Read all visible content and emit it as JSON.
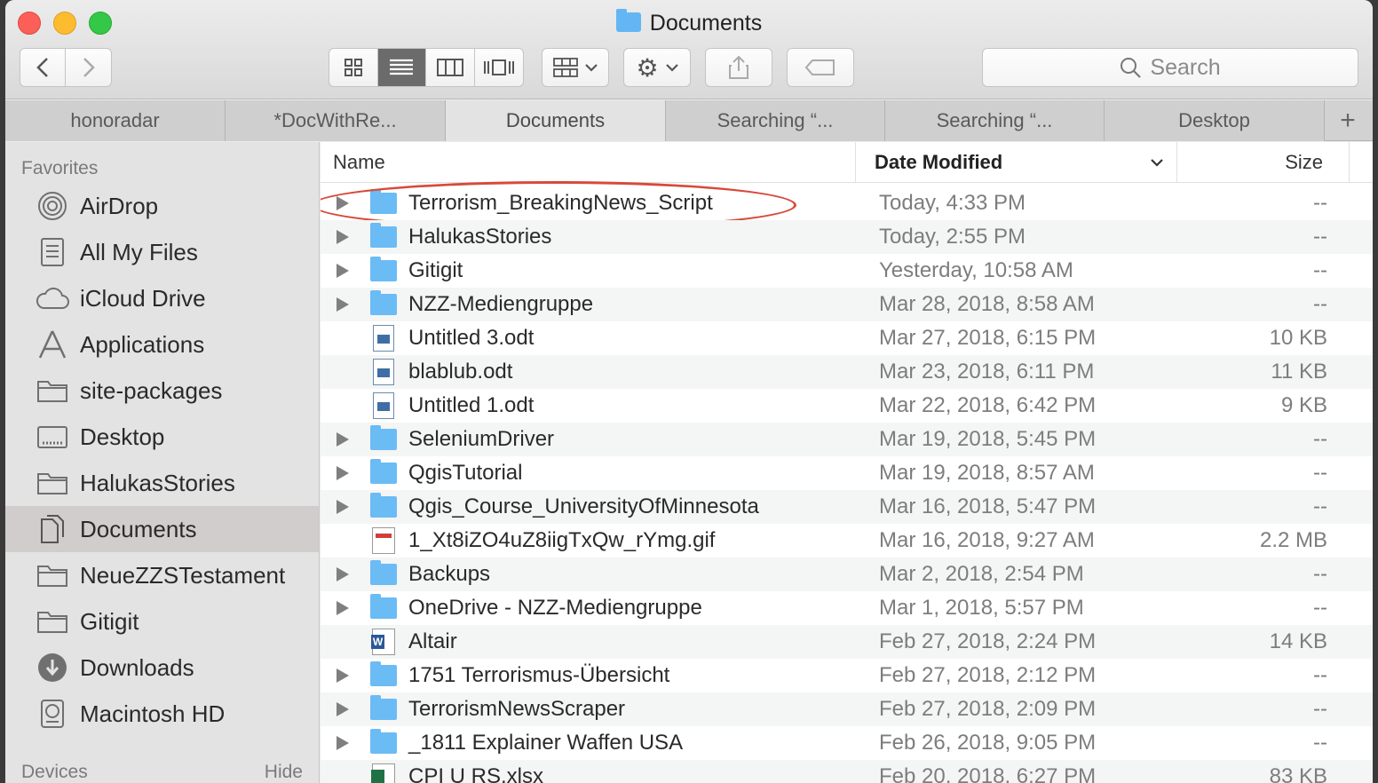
{
  "window": {
    "title": "Documents"
  },
  "toolbar": {
    "search_placeholder": "Search"
  },
  "tabs": [
    {
      "label": "honoradar"
    },
    {
      "label": "*DocWithRe..."
    },
    {
      "label": "Documents"
    },
    {
      "label": "Searching “..."
    },
    {
      "label": "Searching “..."
    },
    {
      "label": "Desktop"
    }
  ],
  "sidebar": {
    "favorites_header": "Favorites",
    "items": [
      {
        "label": "AirDrop",
        "icon": "airdrop-icon"
      },
      {
        "label": "All My Files",
        "icon": "all-files-icon"
      },
      {
        "label": "iCloud Drive",
        "icon": "cloud-icon"
      },
      {
        "label": "Applications",
        "icon": "applications-icon"
      },
      {
        "label": "site-packages",
        "icon": "folder-icon"
      },
      {
        "label": "Desktop",
        "icon": "desktop-folder-icon"
      },
      {
        "label": "HalukasStories",
        "icon": "folder-icon"
      },
      {
        "label": "Documents",
        "icon": "documents-icon",
        "selected": true
      },
      {
        "label": "NeueZZSTestament",
        "icon": "folder-icon"
      },
      {
        "label": "Gitigit",
        "icon": "folder-icon"
      },
      {
        "label": "Downloads",
        "icon": "downloads-icon"
      },
      {
        "label": "Macintosh HD",
        "icon": "disk-icon"
      }
    ],
    "devices_header": "Devices",
    "hide_label": "Hide"
  },
  "columns": {
    "name": "Name",
    "date": "Date Modified",
    "size": "Size"
  },
  "files": [
    {
      "name": "Terrorism_BreakingNews_Script",
      "date": "Today, 4:33 PM",
      "size": "--",
      "kind": "folder"
    },
    {
      "name": "HalukasStories",
      "date": "Today, 2:55 PM",
      "size": "--",
      "kind": "folder"
    },
    {
      "name": "Gitigit",
      "date": "Yesterday, 10:58 AM",
      "size": "--",
      "kind": "folder"
    },
    {
      "name": "NZZ-Mediengruppe",
      "date": "Mar 28, 2018, 8:58 AM",
      "size": "--",
      "kind": "folder"
    },
    {
      "name": "Untitled 3.odt",
      "date": "Mar 27, 2018, 6:15 PM",
      "size": "10 KB",
      "kind": "doc"
    },
    {
      "name": "blablub.odt",
      "date": "Mar 23, 2018, 6:11 PM",
      "size": "11 KB",
      "kind": "doc"
    },
    {
      "name": "Untitled 1.odt",
      "date": "Mar 22, 2018, 6:42 PM",
      "size": "9 KB",
      "kind": "doc"
    },
    {
      "name": "SeleniumDriver",
      "date": "Mar 19, 2018, 5:45 PM",
      "size": "--",
      "kind": "folder"
    },
    {
      "name": "QgisTutorial",
      "date": "Mar 19, 2018, 8:57 AM",
      "size": "--",
      "kind": "folder"
    },
    {
      "name": "Qgis_Course_UniversityOfMinnesota",
      "date": "Mar 16, 2018, 5:47 PM",
      "size": "--",
      "kind": "folder"
    },
    {
      "name": "1_Xt8iZO4uZ8iigTxQw_rYmg.gif",
      "date": "Mar 16, 2018, 9:27 AM",
      "size": "2.2 MB",
      "kind": "gif"
    },
    {
      "name": "Backups",
      "date": "Mar 2, 2018, 2:54 PM",
      "size": "--",
      "kind": "folder"
    },
    {
      "name": "OneDrive - NZZ-Mediengruppe",
      "date": "Mar 1, 2018, 5:57 PM",
      "size": "--",
      "kind": "folder"
    },
    {
      "name": "Altair",
      "date": "Feb 27, 2018, 2:24 PM",
      "size": "14 KB",
      "kind": "word"
    },
    {
      "name": "1751 Terrorismus-Übersicht",
      "date": "Feb 27, 2018, 2:12 PM",
      "size": "--",
      "kind": "folder"
    },
    {
      "name": "TerrorismNewsScraper",
      "date": "Feb 27, 2018, 2:09 PM",
      "size": "--",
      "kind": "folder"
    },
    {
      "name": "_1811 Explainer Waffen USA",
      "date": "Feb 26, 2018, 9:05 PM",
      "size": "--",
      "kind": "folder"
    },
    {
      "name": "CPI U RS.xlsx",
      "date": "Feb 20, 2018, 6:27 PM",
      "size": "83 KB",
      "kind": "xlsx"
    }
  ],
  "colors": {
    "folder": "#6bbbf5",
    "annotation": "#d84a3a",
    "selected_sidebar": "#d1cdcd"
  }
}
